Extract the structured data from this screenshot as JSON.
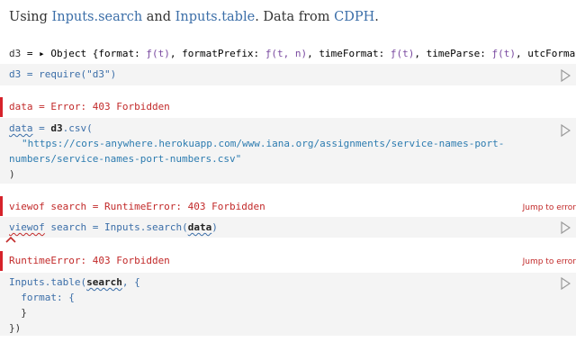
{
  "prose": {
    "pre": "Using ",
    "link_search": "Inputs.search",
    "mid": " and ",
    "link_table": "Inputs.table",
    "post": ". Data from ",
    "link_cdph": "CDPH",
    "end": "."
  },
  "cells": {
    "d3_output": {
      "name": "d3",
      "eq": " = ",
      "arrow": "▸",
      "text": "Object {format: ",
      "f1": "ƒ(t)",
      "c1": ", formatPrefix: ",
      "f2": "ƒ(t, n)",
      "c2": ", timeFormat: ",
      "f3": "ƒ(t)",
      "c3": ", timeParse: ",
      "f4": "ƒ(t)",
      "c4": ", utcFormat:"
    },
    "d3_code": {
      "text": "d3 = require(\"d3\")"
    },
    "data_error": {
      "text": "data = Error: 403 Forbidden"
    },
    "data_code": {
      "line1_name": "data",
      "line1_eq": " = ",
      "line1_call": "d3",
      "line1_rest": ".csv(",
      "line2": "\"https://cors-anywhere.herokuapp.com/www.iana.org/assignments/service-names-port-",
      "line3": "numbers/service-names-port-numbers.csv\"",
      "line4": ")"
    },
    "search_error": {
      "text": "viewof search = RuntimeError: 403 Forbidden",
      "jump": "Jump to error"
    },
    "search_code": {
      "kw": "viewof",
      "rest": " search = Inputs.search(",
      "arg": "data",
      "close": ")"
    },
    "table_error": {
      "text": "RuntimeError: 403 Forbidden",
      "jump": "Jump to error"
    },
    "table_code": {
      "line1_pre": "Inputs.table(",
      "line1_arg": "search",
      "line1_post": ", {",
      "line2": "  format: {",
      "line3": "  }",
      "line4": "})"
    }
  },
  "icons": {
    "run": "play-icon",
    "caret": "caret-up-icon"
  },
  "colors": {
    "error": "#c22a2a",
    "link": "#3b6ea8",
    "code_bg": "#f4f4f4"
  }
}
